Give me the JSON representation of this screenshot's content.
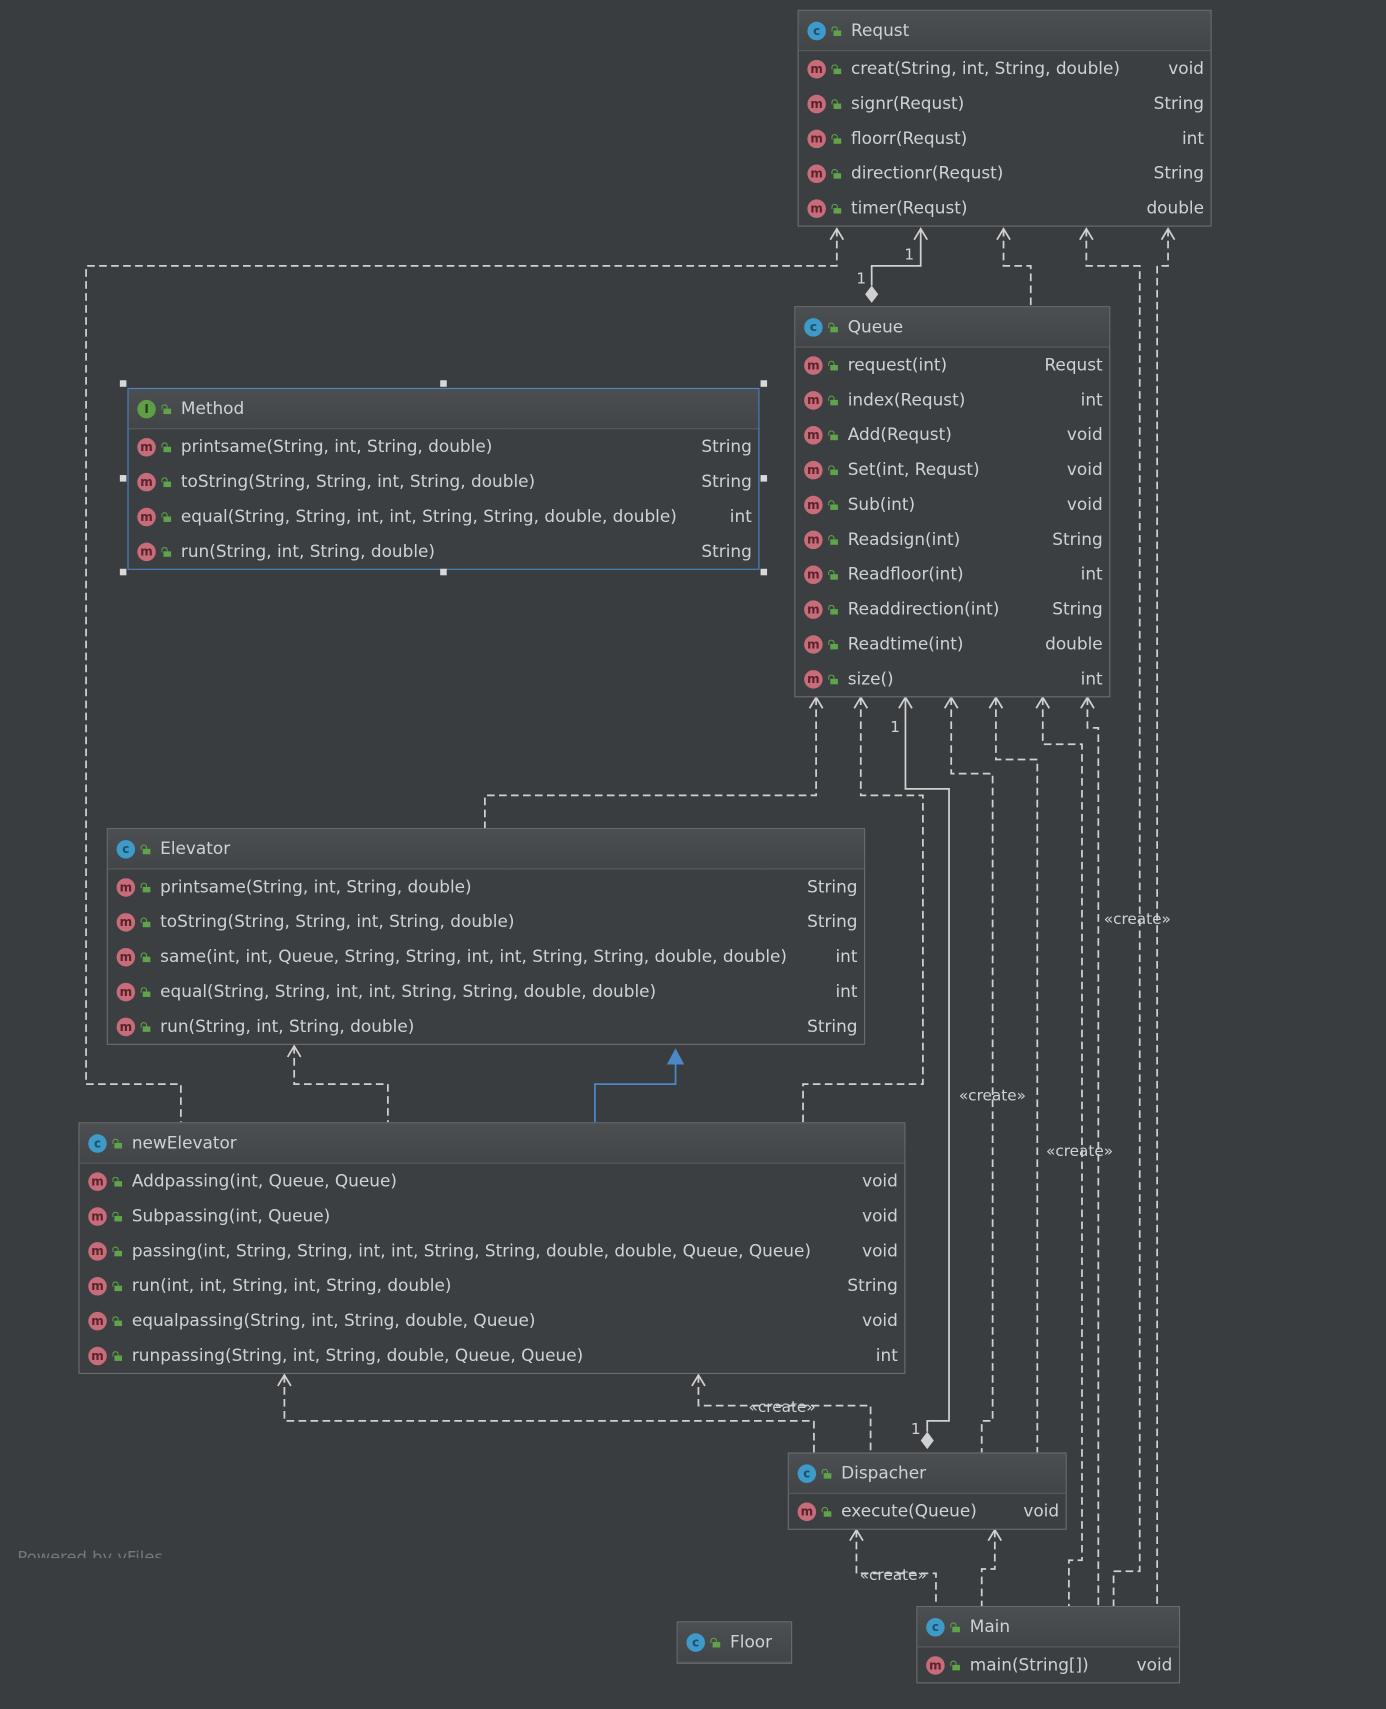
{
  "colors": {
    "background": "#3a3d40",
    "class_icon": "#3d9ac9",
    "method_icon": "#c76c7a",
    "interface_icon": "#5e9e44",
    "visibility_icon": "#5fa34a",
    "selection": "#4a88c7",
    "inheritance": "#4a88c7"
  },
  "icons": {
    "class": "c",
    "method": "m",
    "interface": "I"
  },
  "classes": [
    {
      "name": "Requst",
      "kind": "class",
      "methods": [
        {
          "sig": "creat(String, int, String, double)",
          "ret": "void"
        },
        {
          "sig": "signr(Requst)",
          "ret": "String"
        },
        {
          "sig": "floorr(Requst)",
          "ret": "int"
        },
        {
          "sig": "directionr(Requst)",
          "ret": "String"
        },
        {
          "sig": "timer(Requst)",
          "ret": "double"
        }
      ]
    },
    {
      "name": "Queue",
      "kind": "class",
      "methods": [
        {
          "sig": "request(int)",
          "ret": "Requst"
        },
        {
          "sig": "index(Requst)",
          "ret": "int"
        },
        {
          "sig": "Add(Requst)",
          "ret": "void"
        },
        {
          "sig": "Set(int, Requst)",
          "ret": "void"
        },
        {
          "sig": "Sub(int)",
          "ret": "void"
        },
        {
          "sig": "Readsign(int)",
          "ret": "String"
        },
        {
          "sig": "Readfloor(int)",
          "ret": "int"
        },
        {
          "sig": "Readdirection(int)",
          "ret": "String"
        },
        {
          "sig": "Readtime(int)",
          "ret": "double"
        },
        {
          "sig": "size()",
          "ret": "int"
        }
      ]
    },
    {
      "name": "Method",
      "kind": "interface",
      "selected": true,
      "methods": [
        {
          "sig": "printsame(String, int, String, double)",
          "ret": "String"
        },
        {
          "sig": "toString(String, String, int, String, double)",
          "ret": "String"
        },
        {
          "sig": "equal(String, String, int, int, String, String, double, double)",
          "ret": "int"
        },
        {
          "sig": "run(String, int, String, double)",
          "ret": "String"
        }
      ]
    },
    {
      "name": "Elevator",
      "kind": "class",
      "methods": [
        {
          "sig": "printsame(String, int, String, double)",
          "ret": "String"
        },
        {
          "sig": "toString(String, String, int, String, double)",
          "ret": "String"
        },
        {
          "sig": "same(int, int, Queue, String, String, int, int, String, String, double, double)",
          "ret": "int"
        },
        {
          "sig": "equal(String, String, int, int, String, String, double, double)",
          "ret": "int"
        },
        {
          "sig": "run(String, int, String, double)",
          "ret": "String"
        }
      ]
    },
    {
      "name": "newElevator",
      "kind": "class",
      "methods": [
        {
          "sig": "Addpassing(int, Queue, Queue)",
          "ret": "void"
        },
        {
          "sig": "Subpassing(int, Queue)",
          "ret": "void"
        },
        {
          "sig": "passing(int, String, String, int, int, String, String, double, double, Queue, Queue)",
          "ret": "void"
        },
        {
          "sig": "run(int, int, String, int, String, double)",
          "ret": "String"
        },
        {
          "sig": "equalpassing(String, int, String, double, Queue)",
          "ret": "void"
        },
        {
          "sig": "runpassing(String, int, String, double, Queue, Queue)",
          "ret": "int"
        }
      ]
    },
    {
      "name": "Dispacher",
      "kind": "class",
      "methods": [
        {
          "sig": "execute(Queue)",
          "ret": "void"
        }
      ]
    },
    {
      "name": "Floor",
      "kind": "class",
      "methods": []
    },
    {
      "name": "Main",
      "kind": "class",
      "methods": [
        {
          "sig": "main(String[])",
          "ret": "void"
        }
      ]
    }
  ],
  "edge_labels": {
    "mult_requst_target": "1",
    "mult_queue_source": "1",
    "mult_queue_target": "1",
    "mult_dispacher_source": "1",
    "create_1": "«create»",
    "create_2": "«create»",
    "create_3": "«create»",
    "create_4": "«create»",
    "create_5": "«create»"
  },
  "watermark": "Powered by yFiles"
}
